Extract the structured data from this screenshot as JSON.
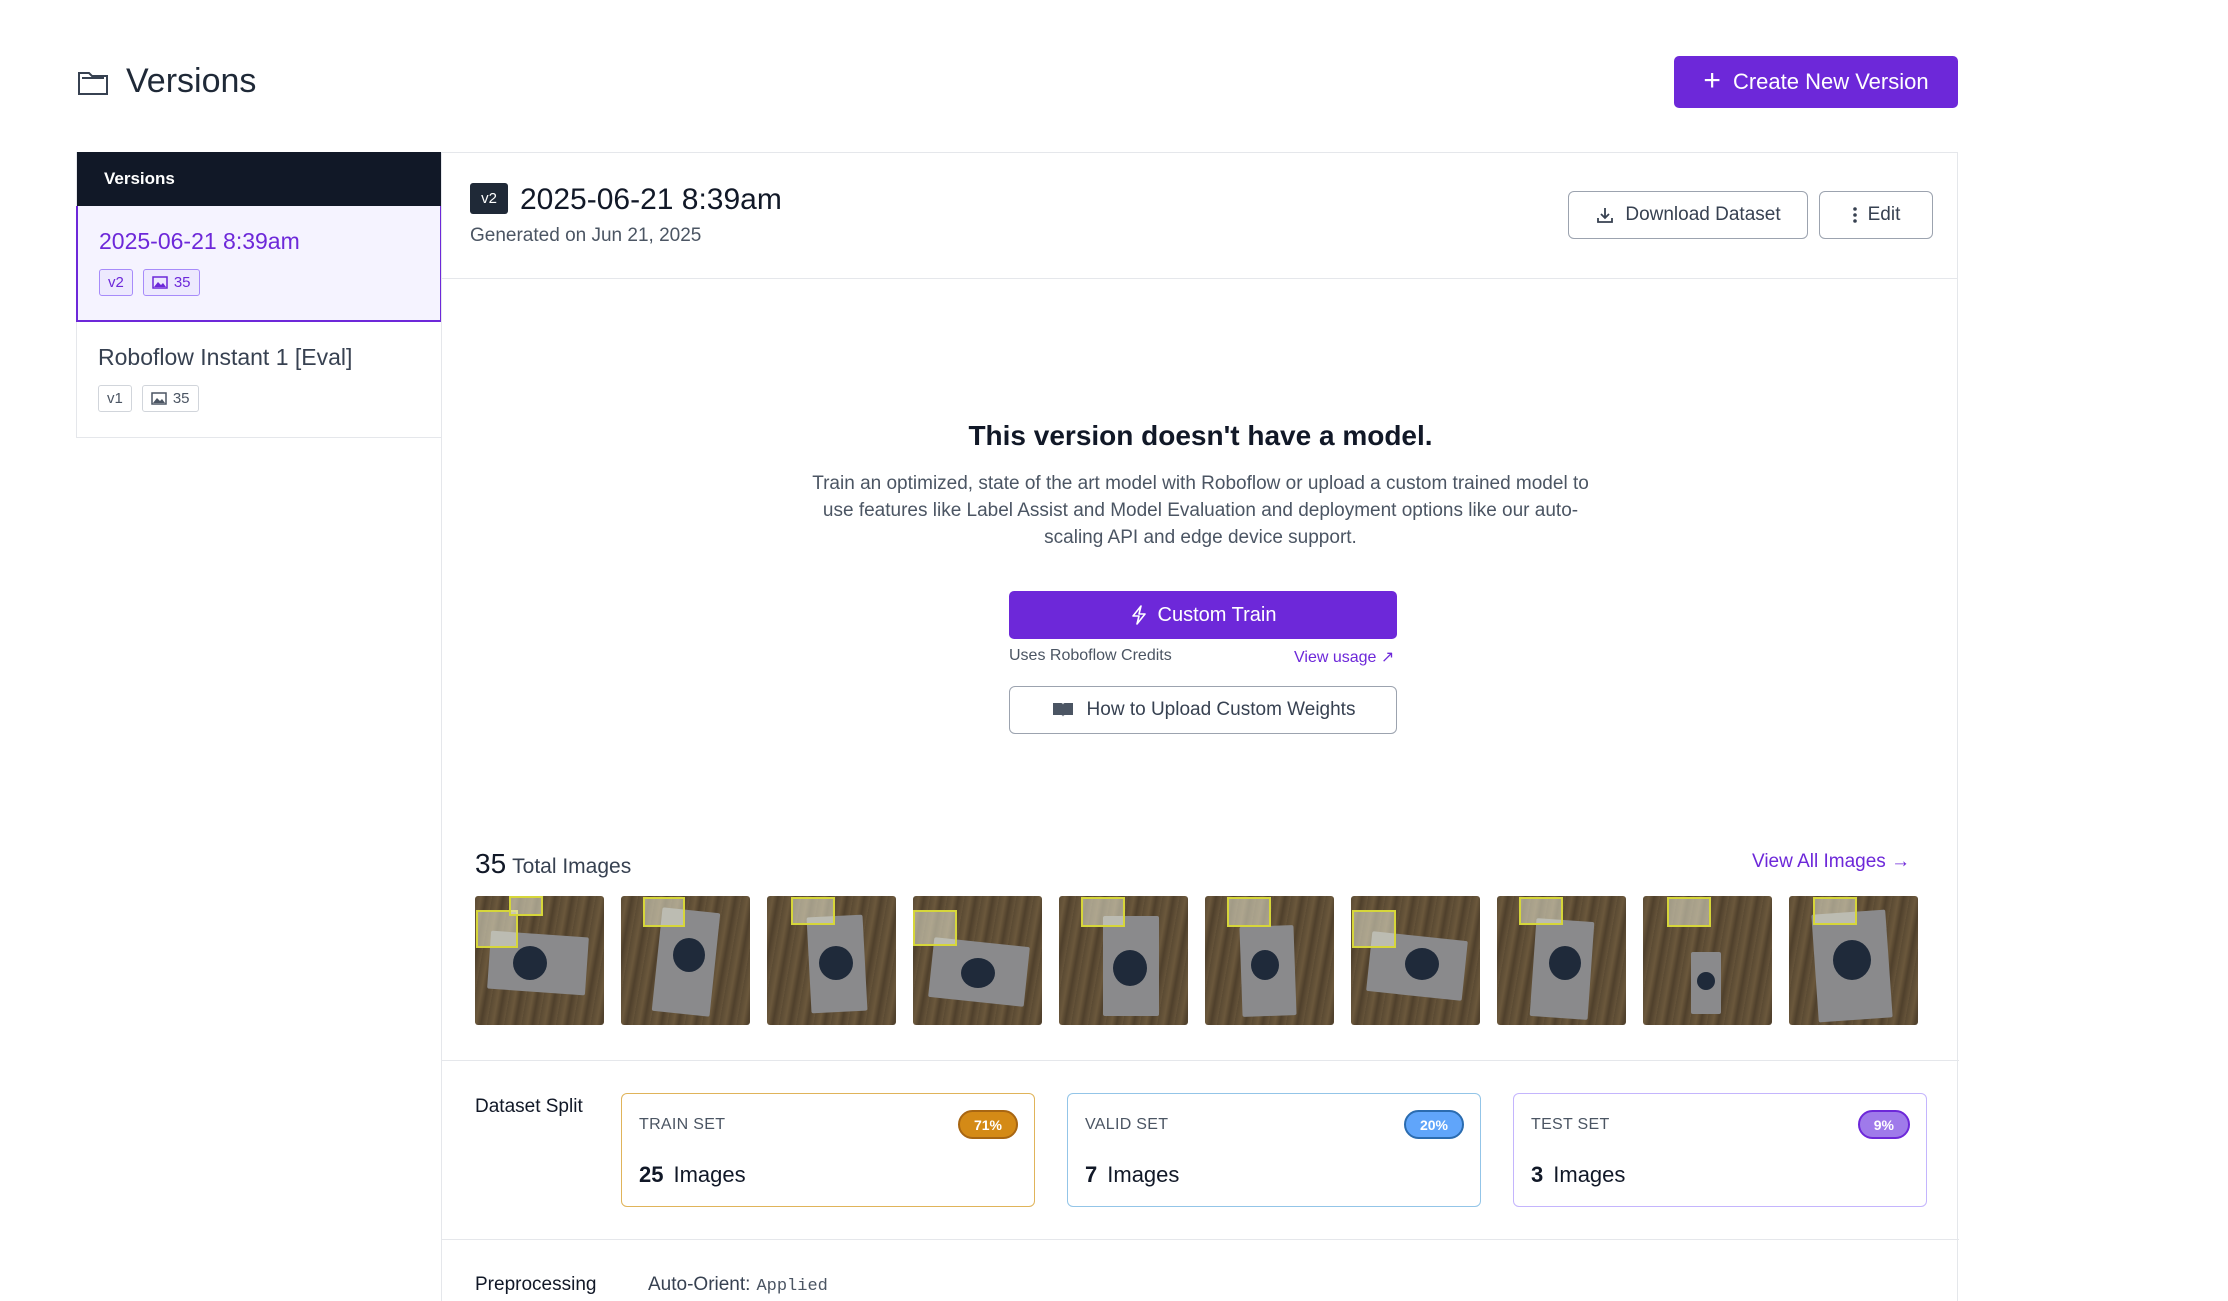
{
  "page": {
    "title": "Versions",
    "create_button": "Create New Version"
  },
  "sidebar": {
    "heading": "Versions",
    "items": [
      {
        "name": "2025-06-21 8:39am",
        "version": "v2",
        "images": "35",
        "active": true
      },
      {
        "name": "Roboflow Instant 1 [Eval]",
        "version": "v1",
        "images": "35",
        "active": false
      }
    ]
  },
  "main": {
    "version_badge": "v2",
    "title": "2025-06-21 8:39am",
    "subtitle": "Generated on Jun 21, 2025",
    "download_button": "Download Dataset",
    "edit_button": "Edit"
  },
  "no_model": {
    "title": "This version doesn't have a model.",
    "description": "Train an optimized, state of the art model with Roboflow or upload a custom trained model to use features like Label Assist and Model Evaluation and deployment options like our auto-scaling API and edge device support.",
    "train_button": "Custom Train",
    "credits_note": "Uses Roboflow Credits",
    "usage_link": "View usage",
    "weights_button": "How to Upload Custom Weights"
  },
  "images": {
    "total": "35",
    "total_label": "Total Images",
    "view_all": "View All Images",
    "thumbnails_count": 10
  },
  "split": {
    "label": "Dataset Split",
    "train": {
      "title": "TRAIN SET",
      "count": "25",
      "unit": "Images",
      "percent": "71%"
    },
    "valid": {
      "title": "VALID SET",
      "count": "7",
      "unit": "Images",
      "percent": "20%"
    },
    "test": {
      "title": "TEST SET",
      "count": "3",
      "unit": "Images",
      "percent": "9%"
    }
  },
  "preprocessing": {
    "label": "Preprocessing",
    "key": "Auto-Orient:",
    "value": "Applied"
  },
  "colors": {
    "accent": "#6d28d9",
    "sidebar_header": "#111827",
    "train": "#d48a16",
    "valid": "#60a5fa",
    "test": "#9f7aea"
  },
  "icons": [
    "folder-icon",
    "plus-icon",
    "image-icon",
    "download-icon",
    "more-vertical-icon",
    "lightning-icon",
    "external-link-icon",
    "book-icon",
    "arrow-right-icon"
  ]
}
